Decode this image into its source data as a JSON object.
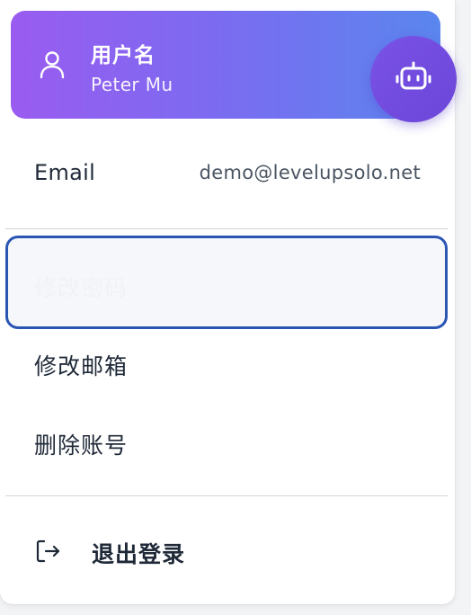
{
  "header": {
    "user_label": "用户名",
    "user_name": "Peter Mu",
    "user_icon": "user-icon",
    "bot_icon": "robot-icon",
    "gradient_start": "#9a5cf0",
    "gradient_end": "#5a86ee"
  },
  "email": {
    "label": "Email",
    "value": "demo@levelupsolo.net"
  },
  "menu": {
    "items": [
      {
        "label": "修改密码",
        "state": "focused"
      },
      {
        "label": "修改邮箱"
      },
      {
        "label": "删除账号"
      }
    ],
    "logout_label": "退出登录",
    "logout_icon": "logout-icon"
  },
  "colors": {
    "focus_border": "#2a55b3",
    "bot_button": "#6b46d8"
  }
}
